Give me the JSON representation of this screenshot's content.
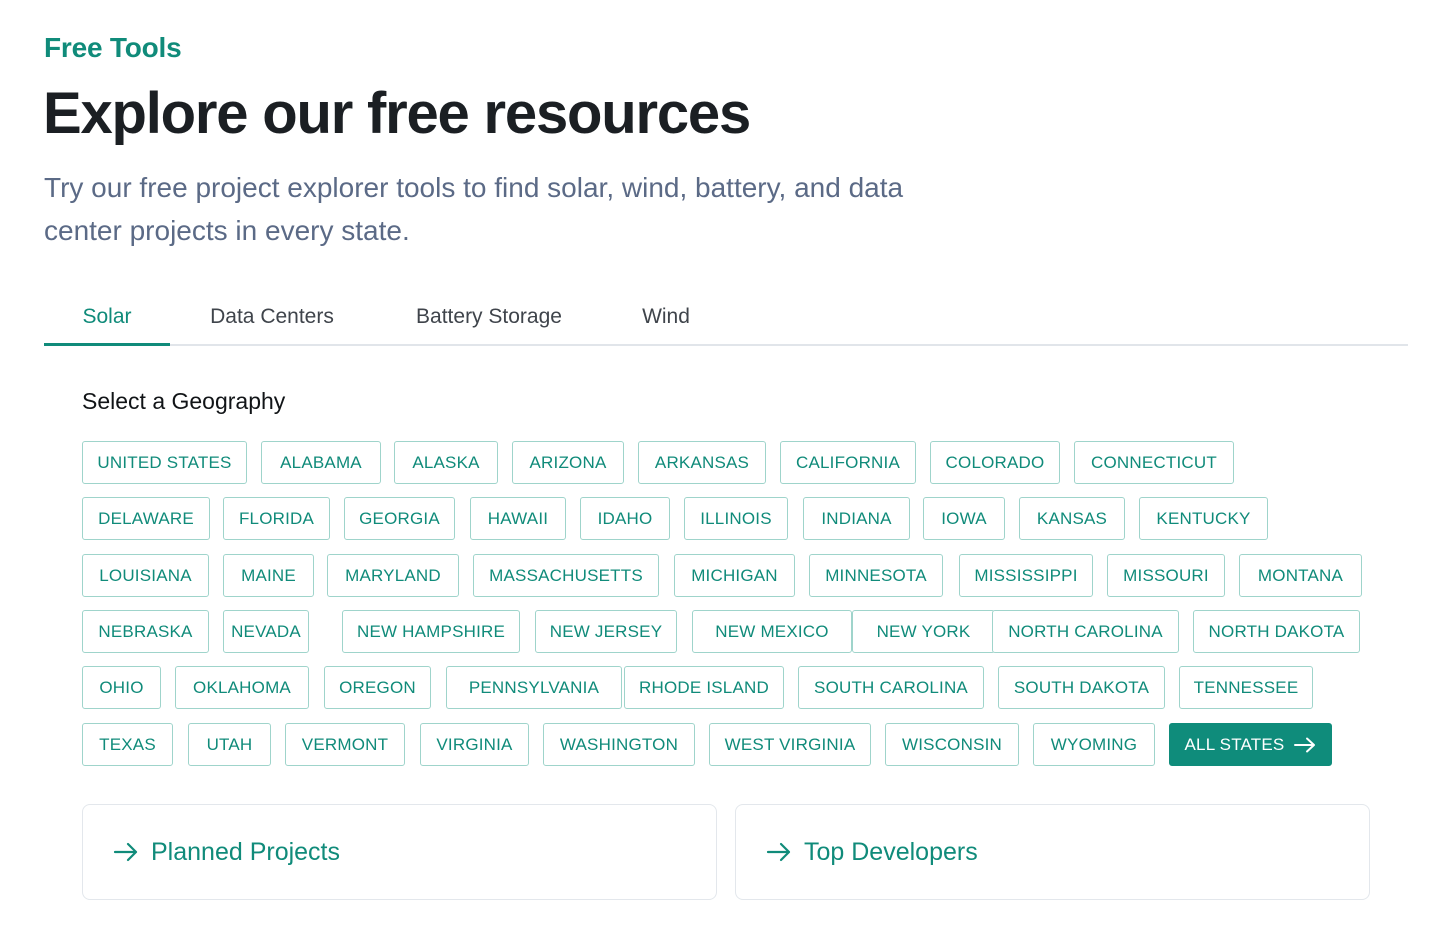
{
  "header": {
    "eyebrow": "Free Tools",
    "title": "Explore our free resources",
    "subtitle": "Try our free project explorer tools to find solar, wind, battery, and data center projects in every state."
  },
  "tabs": [
    {
      "label": "Solar",
      "active": true
    },
    {
      "label": "Data Centers",
      "active": false
    },
    {
      "label": "Battery Storage",
      "active": false
    },
    {
      "label": "Wind",
      "active": false
    }
  ],
  "geography": {
    "heading": "Select a Geography",
    "rows": [
      [
        "UNITED STATES",
        "ALABAMA",
        "ALASKA",
        "ARIZONA",
        "ARKANSAS",
        "CALIFORNIA",
        "COLORADO",
        "CONNECTICUT"
      ],
      [
        "DELAWARE",
        "FLORIDA",
        "GEORGIA",
        "HAWAII",
        "IDAHO",
        "ILLINOIS",
        "INDIANA",
        "IOWA",
        "KANSAS",
        "KENTUCKY"
      ],
      [
        "LOUISIANA",
        "MAINE",
        "MARYLAND",
        "MASSACHUSETTS",
        "MICHIGAN",
        "MINNESOTA",
        "MISSISSIPPI",
        "MISSOURI",
        "MONTANA"
      ],
      [
        "NEBRASKA",
        "NEVADA",
        "NEW HAMPSHIRE",
        "NEW JERSEY",
        "NEW MEXICO",
        "NEW YORK",
        "NORTH CAROLINA",
        "NORTH DAKOTA"
      ],
      [
        "OHIO",
        "OKLAHOMA",
        "OREGON",
        "PENNSYLVANIA",
        "RHODE ISLAND",
        "SOUTH CAROLINA",
        "SOUTH DAKOTA",
        "TENNESSEE"
      ],
      [
        "TEXAS",
        "UTAH",
        "VERMONT",
        "VIRGINIA",
        "WASHINGTON",
        "WEST VIRGINIA",
        "WISCONSIN",
        "WYOMING"
      ]
    ],
    "all_states_label": "ALL STATES"
  },
  "cards": [
    {
      "label": "Planned Projects"
    },
    {
      "label": "Top Developers"
    }
  ],
  "colors": {
    "accent": "#108b7a",
    "chip_border": "#9fd4cb",
    "subtitle": "#5b6a86"
  },
  "icons": {
    "all_states": "arrow-right-icon",
    "card": "arrow-right-icon"
  }
}
